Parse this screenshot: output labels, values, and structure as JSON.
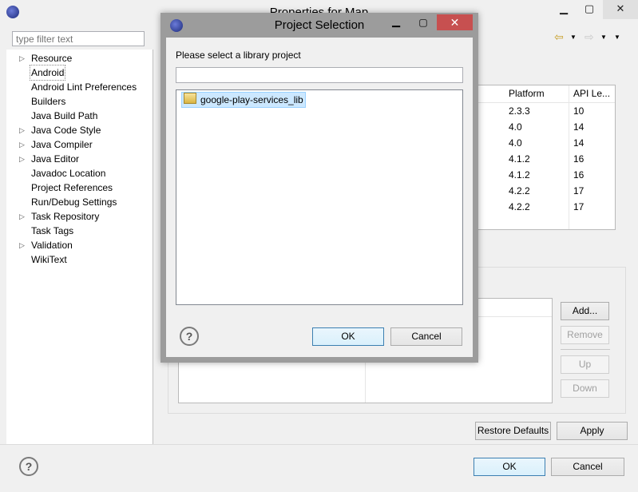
{
  "main": {
    "title": "Properties for Map",
    "filter_placeholder": "type filter text",
    "tree": [
      {
        "label": "Resource",
        "expandable": true
      },
      {
        "label": "Android",
        "expandable": false,
        "selected": true
      },
      {
        "label": "Android Lint Preferences",
        "expandable": false
      },
      {
        "label": "Builders",
        "expandable": false
      },
      {
        "label": "Java Build Path",
        "expandable": false
      },
      {
        "label": "Java Code Style",
        "expandable": true
      },
      {
        "label": "Java Compiler",
        "expandable": true
      },
      {
        "label": "Java Editor",
        "expandable": true
      },
      {
        "label": "Javadoc Location",
        "expandable": false
      },
      {
        "label": "Project References",
        "expandable": false
      },
      {
        "label": "Run/Debug Settings",
        "expandable": false
      },
      {
        "label": "Task Repository",
        "expandable": true
      },
      {
        "label": "Task Tags",
        "expandable": false
      },
      {
        "label": "Validation",
        "expandable": true
      },
      {
        "label": "WikiText",
        "expandable": false
      }
    ],
    "target_table": {
      "headers": [
        "Platform",
        "API Le..."
      ],
      "rows": [
        [
          "2.3.3",
          "10"
        ],
        [
          "4.0",
          "14"
        ],
        [
          "4.0",
          "14"
        ],
        [
          "4.1.2",
          "16"
        ],
        [
          "4.1.2",
          "16"
        ],
        [
          "4.2.2",
          "17"
        ],
        [
          "4.2.2",
          "17"
        ]
      ]
    },
    "library_buttons": {
      "add": "Add...",
      "remove": "Remove",
      "up": "Up",
      "down": "Down"
    },
    "restore_defaults": "Restore Defaults",
    "apply": "Apply",
    "ok": "OK",
    "cancel": "Cancel"
  },
  "dialog": {
    "title": "Project Selection",
    "prompt": "Please select a library project",
    "filter_value": "",
    "items": [
      "google-play-services_lib"
    ],
    "ok": "OK",
    "cancel": "Cancel"
  },
  "icons": {
    "help": "?",
    "back": "⇦",
    "forward": "⇨",
    "dropdown": "▼",
    "expand": "▷"
  },
  "colors": {
    "selection": "#cce8ff",
    "dialog_close": "#c75050"
  }
}
